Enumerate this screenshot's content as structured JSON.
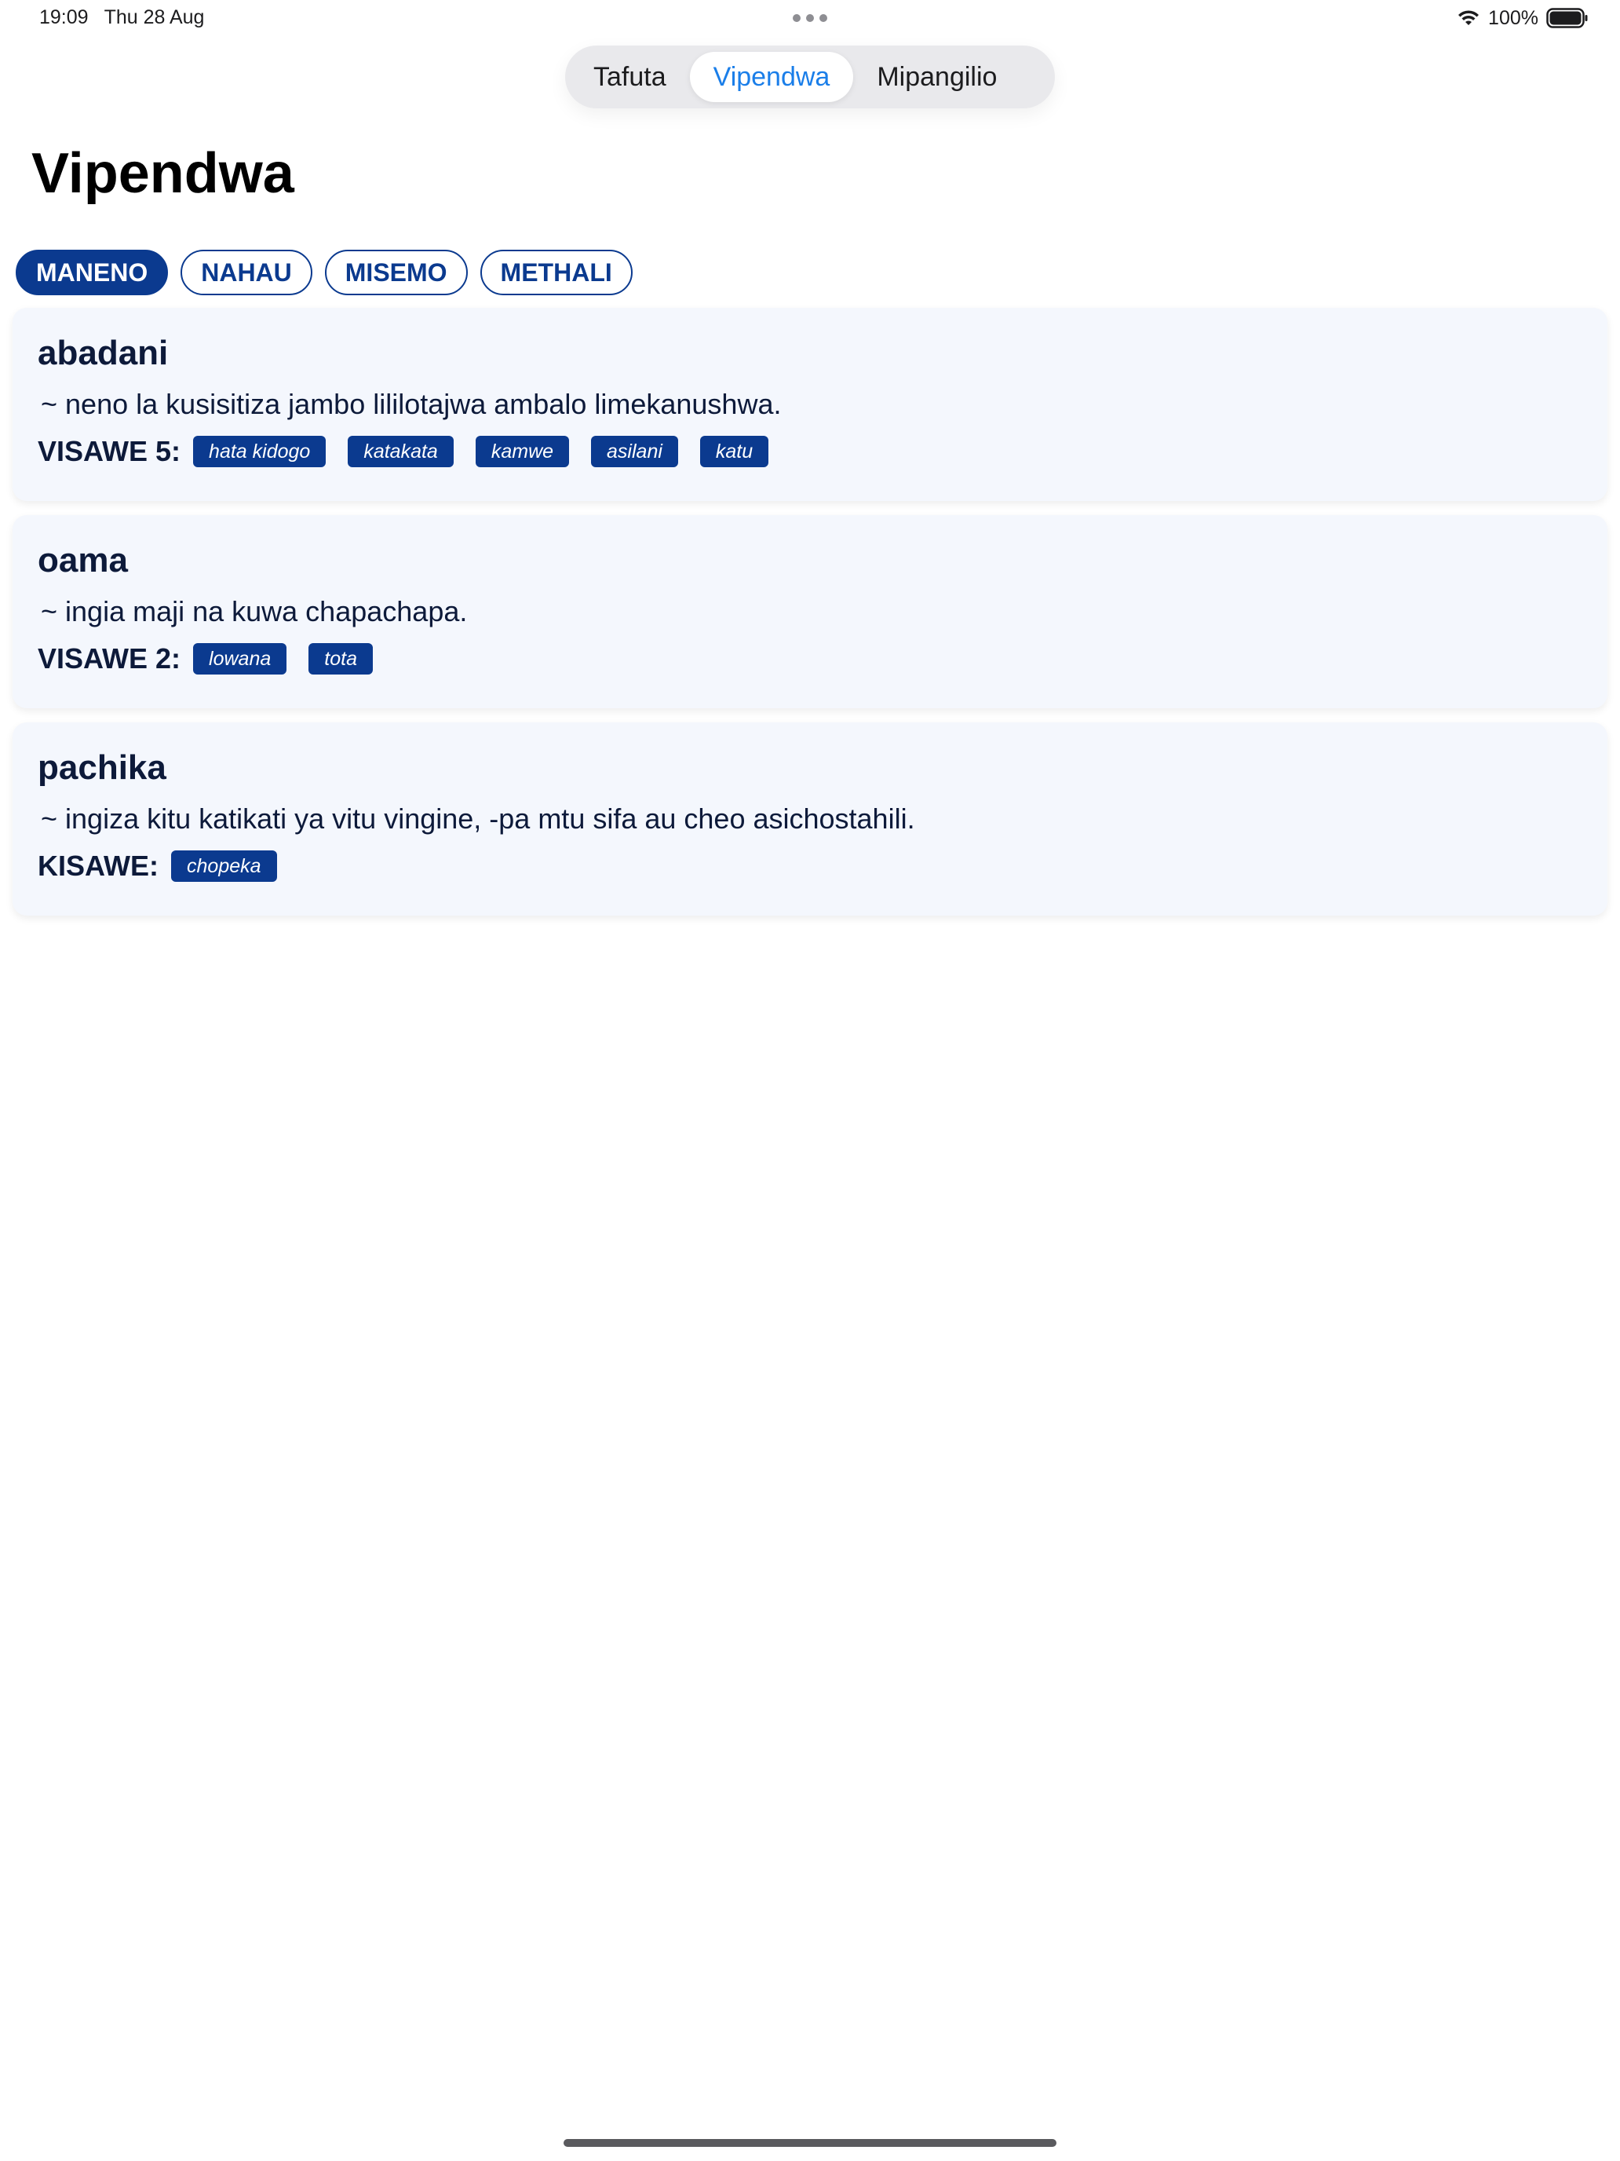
{
  "status_bar": {
    "time": "19:09",
    "date": "Thu 28 Aug",
    "battery": "100%",
    "icons": [
      "wifi-icon",
      "battery-icon",
      "multitask-dots-icon"
    ]
  },
  "nav": {
    "tabs": [
      {
        "label": "Tafuta",
        "active": false
      },
      {
        "label": "Vipendwa",
        "active": true
      },
      {
        "label": "Mipangilio",
        "active": false
      }
    ]
  },
  "page": {
    "title": "Vipendwa"
  },
  "filters": [
    {
      "label": "MANENO",
      "active": true
    },
    {
      "label": "NAHAU",
      "active": false
    },
    {
      "label": "MISEMO",
      "active": false
    },
    {
      "label": "METHALI",
      "active": false
    }
  ],
  "entries": [
    {
      "word": "abadani",
      "definition": "~ neno la kusisitiza jambo lililotajwa ambalo limekanushwa.",
      "synonym_label": "VISAWE 5:",
      "synonyms": [
        "hata kidogo",
        "katakata",
        "kamwe",
        "asilani",
        "katu"
      ]
    },
    {
      "word": "oama",
      "definition": "~ ingia maji na kuwa chapachapa.",
      "synonym_label": "VISAWE 2:",
      "synonyms": [
        "lowana",
        "tota"
      ]
    },
    {
      "word": "pachika",
      "definition": "~ ingiza kitu katikati ya vitu vingine, -pa mtu sifa au cheo asichostahili.",
      "synonym_label": "KISAWE:",
      "synonyms": [
        "chopeka"
      ]
    }
  ],
  "colors": {
    "accent_blue": "#1a7ee9",
    "chip_navy": "#0b3a8f",
    "card_bg": "#f4f7fd",
    "text_dark": "#0d1a3a"
  }
}
